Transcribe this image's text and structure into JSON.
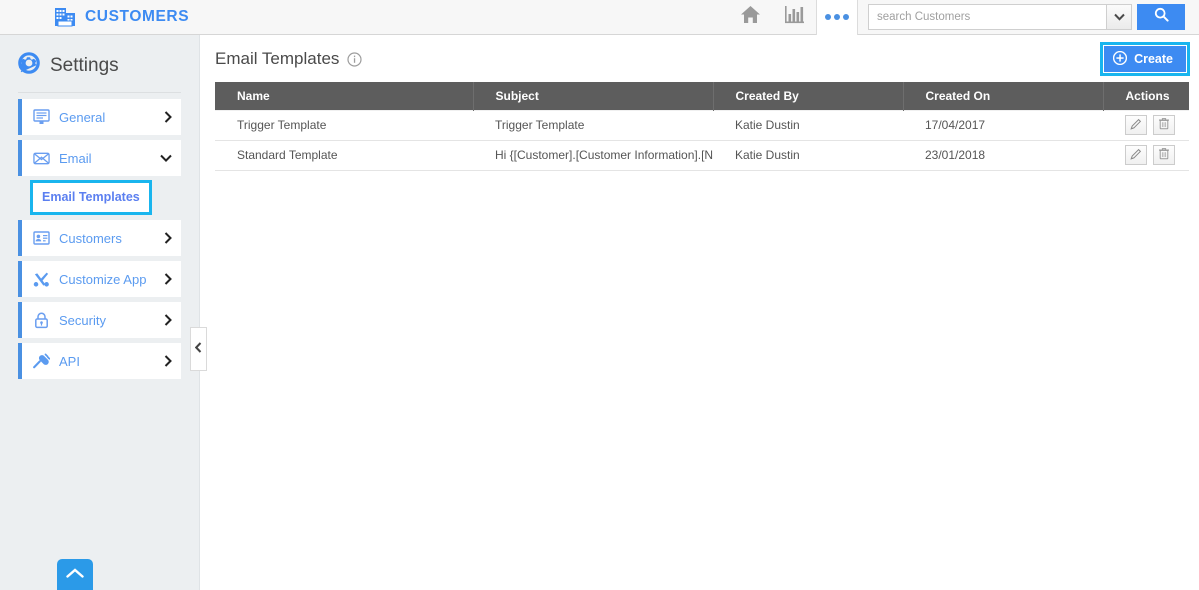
{
  "topbar": {
    "brand_label": "CUSTOMERS",
    "brand_icon": "building-icon",
    "home_icon": "home-icon",
    "reports_icon": "bar-chart-icon",
    "more_icon": "ellipsis-icon",
    "search": {
      "placeholder": "search Customers",
      "value": "",
      "dropdown_icon": "chevron-down-icon",
      "submit_icon": "search-icon"
    },
    "accent_color": "#3d8bf2"
  },
  "sidebar": {
    "title": "Settings",
    "title_icon": "gear-icon",
    "items": [
      {
        "label": "General",
        "icon": "monitor-icon",
        "chevron": "chevron-right-icon",
        "expanded": false
      },
      {
        "label": "Email",
        "icon": "envelope-icon",
        "chevron": "chevron-down-icon",
        "expanded": true
      },
      {
        "label": "Customers",
        "icon": "contact-card-icon",
        "chevron": "chevron-right-icon",
        "expanded": false
      },
      {
        "label": "Customize App",
        "icon": "tools-icon",
        "chevron": "chevron-right-icon",
        "expanded": false
      },
      {
        "label": "Security",
        "icon": "lock-icon",
        "chevron": "chevron-right-icon",
        "expanded": false
      },
      {
        "label": "API",
        "icon": "plug-icon",
        "chevron": "chevron-right-icon",
        "expanded": false
      }
    ],
    "subitem": {
      "label": "Email Templates",
      "selected": true,
      "highlight_color": "#19b5ee"
    },
    "collapse_icon": "chevron-left-icon",
    "scroll_top_icon": "chevron-up-icon",
    "scroll_top_color": "#2b9ae8",
    "background_color": "#eceff1",
    "item_accent_color": "#4a90e2",
    "label_color": "#5b9bf0"
  },
  "main": {
    "page_title": "Email Templates",
    "info_icon": "info-circle-icon",
    "create_button": {
      "label": "Create",
      "icon": "plus-circle-icon",
      "color": "#3d8bf2",
      "highlight_color": "#19b5ee"
    },
    "table": {
      "header_color": "#5d5d5d",
      "columns": [
        "Name",
        "Subject",
        "Created By",
        "Created On",
        "Actions"
      ],
      "rows": [
        {
          "name": "Trigger Template",
          "subject": "Trigger Template",
          "created_by": "Katie Dustin",
          "created_on": "17/04/2017",
          "actions": [
            "edit-icon",
            "delete-icon"
          ]
        },
        {
          "name": "Standard Template",
          "subject": "Hi {[Customer].[Customer Information].[Name]},",
          "created_by": "Katie Dustin",
          "created_on": "23/01/2018",
          "actions": [
            "edit-icon",
            "delete-icon"
          ]
        }
      ]
    }
  }
}
